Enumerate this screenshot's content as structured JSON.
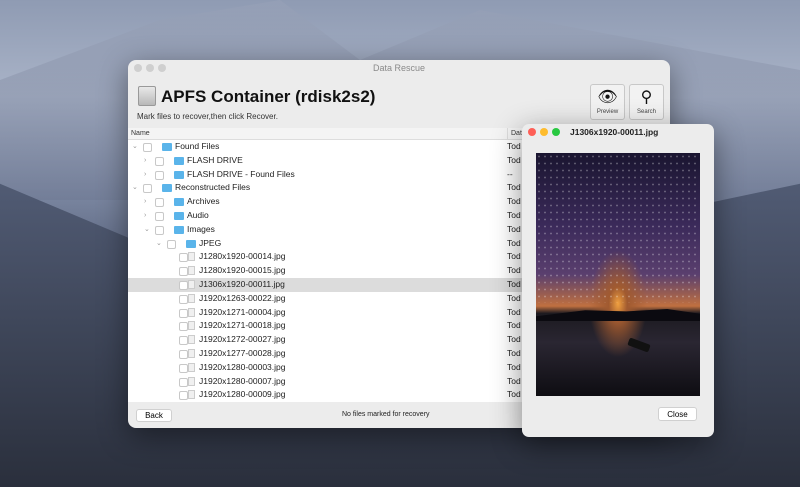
{
  "app": {
    "title": "Data Rescue",
    "heading": "APFS Container (rdisk2s2)",
    "subtitle": "Mark files to recover,then click Recover."
  },
  "toolbar": {
    "preview_label": "Preview",
    "search_label": "Search"
  },
  "columns": {
    "name": "Name",
    "date": "Date"
  },
  "rows": [
    {
      "name": "Found Files",
      "level": 0,
      "type": "folder",
      "expanded": true,
      "date": "Tod"
    },
    {
      "name": "FLASH DRIVE",
      "level": 1,
      "type": "folder",
      "expanded": false,
      "date": "Tod"
    },
    {
      "name": "FLASH DRIVE - Found Files",
      "level": 1,
      "type": "folder",
      "expanded": false,
      "date": "--"
    },
    {
      "name": "Reconstructed Files",
      "level": 0,
      "type": "folder",
      "expanded": true,
      "date": "Tod"
    },
    {
      "name": "Archives",
      "level": 1,
      "type": "folder",
      "expanded": false,
      "date": "Tod"
    },
    {
      "name": "Audio",
      "level": 1,
      "type": "folder",
      "expanded": false,
      "date": "Tod"
    },
    {
      "name": "Images",
      "level": 1,
      "type": "folder",
      "expanded": true,
      "date": "Tod"
    },
    {
      "name": "JPEG",
      "level": 2,
      "type": "folder",
      "expanded": true,
      "date": "Tod"
    },
    {
      "name": "J1280x1920-00014.jpg",
      "level": 3,
      "type": "file",
      "date": "Tod"
    },
    {
      "name": "J1280x1920-00015.jpg",
      "level": 3,
      "type": "file",
      "date": "Tod"
    },
    {
      "name": "J1306x1920-00011.jpg",
      "level": 3,
      "type": "file",
      "date": "Tod",
      "selected": true
    },
    {
      "name": "J1920x1263-00022.jpg",
      "level": 3,
      "type": "file",
      "date": "Tod"
    },
    {
      "name": "J1920x1271-00004.jpg",
      "level": 3,
      "type": "file",
      "date": "Tod"
    },
    {
      "name": "J1920x1271-00018.jpg",
      "level": 3,
      "type": "file",
      "date": "Tod"
    },
    {
      "name": "J1920x1272-00027.jpg",
      "level": 3,
      "type": "file",
      "date": "Tod"
    },
    {
      "name": "J1920x1277-00028.jpg",
      "level": 3,
      "type": "file",
      "date": "Tod"
    },
    {
      "name": "J1920x1280-00003.jpg",
      "level": 3,
      "type": "file",
      "date": "Tod"
    },
    {
      "name": "J1920x1280-00007.jpg",
      "level": 3,
      "type": "file",
      "date": "Tod"
    },
    {
      "name": "J1920x1280-00009.jpg",
      "level": 3,
      "type": "file",
      "date": "Tod"
    }
  ],
  "footer": {
    "back_label": "Back",
    "status": "No files marked for recovery"
  },
  "preview": {
    "title": "J1306x1920-00011.jpg",
    "close_label": "Close"
  }
}
